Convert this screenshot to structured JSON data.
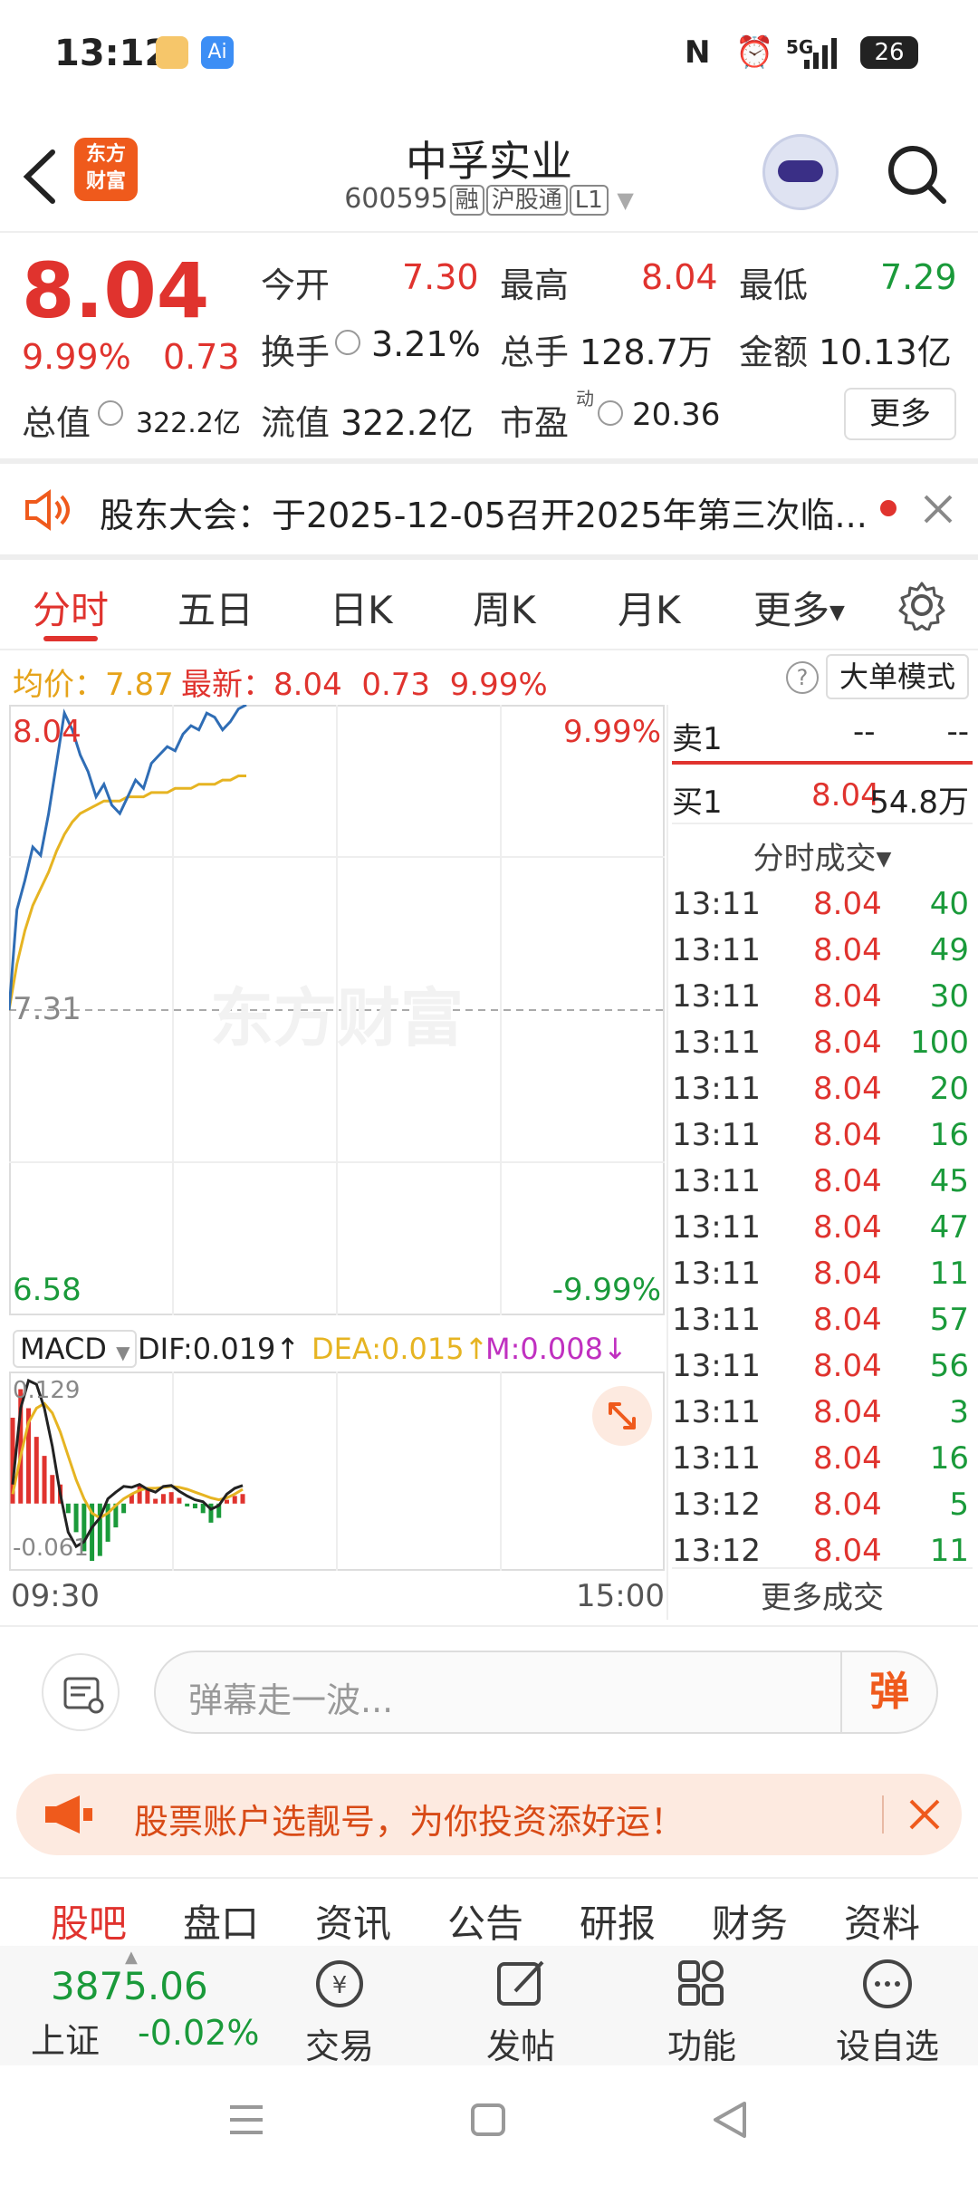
{
  "status_bar": {
    "time": "13:12",
    "battery": "26",
    "network": "5G"
  },
  "header": {
    "logo_line1": "东方",
    "logo_line2": "财富",
    "stock_name": "中孚实业",
    "stock_code": "600595",
    "tags": [
      "融",
      "沪股通",
      "L1"
    ]
  },
  "quote": {
    "price": "8.04",
    "pct": "9.99%",
    "chg": "0.73",
    "open_label": "今开",
    "open": "7.30",
    "high_label": "最高",
    "high": "8.04",
    "low_label": "最低",
    "low": "7.29",
    "turnover_label": "换手",
    "turnover": "3.21%",
    "volume_label": "总手",
    "volume": "128.7万",
    "amount_label": "金额",
    "amount": "10.13亿",
    "mktcap_label": "总值",
    "mktcap": "322.2亿",
    "float_label": "流值",
    "float": "322.2亿",
    "pe_label": "市盈",
    "pe_sup": "动",
    "pe": "20.36",
    "more": "更多"
  },
  "notice": {
    "text": "股东大会：于2025-12-05召开2025年第三次临..."
  },
  "tabs": [
    "分时",
    "五日",
    "日K",
    "周K",
    "月K",
    "更多"
  ],
  "info_line": {
    "avg_label": "均价：",
    "avg": "7.87",
    "latest_label": "最新：",
    "latest": "8.04",
    "chg": "0.73",
    "pct": "9.99%",
    "big_order": "大单模式"
  },
  "chart": {
    "top_price": "8.04",
    "top_pct": "9.99%",
    "mid_price": "7.31",
    "bottom_price": "6.58",
    "bottom_pct": "-9.99%",
    "watermark": "东方财富",
    "time_start": "09:30",
    "time_end": "15:00"
  },
  "chart_data": {
    "type": "line",
    "ylim": [
      6.58,
      8.04
    ],
    "series": [
      {
        "name": "price",
        "values": [
          7.31,
          7.55,
          7.62,
          7.7,
          7.68,
          7.78,
          7.9,
          8.02,
          7.98,
          7.92,
          7.88,
          7.82,
          7.85,
          7.8,
          7.78,
          7.82,
          7.86,
          7.84,
          7.9,
          7.92,
          7.94,
          7.93,
          7.97,
          7.99,
          7.98,
          8.02,
          8.01,
          7.98,
          8.0,
          8.03,
          8.04
        ]
      },
      {
        "name": "avg",
        "values": [
          7.31,
          7.42,
          7.5,
          7.56,
          7.6,
          7.64,
          7.69,
          7.73,
          7.76,
          7.78,
          7.79,
          7.8,
          7.81,
          7.81,
          7.81,
          7.82,
          7.82,
          7.82,
          7.83,
          7.83,
          7.83,
          7.84,
          7.84,
          7.84,
          7.85,
          7.85,
          7.85,
          7.86,
          7.86,
          7.87,
          7.87
        ]
      }
    ]
  },
  "macd": {
    "label": "MACD",
    "dif": "DIF:0.019↑",
    "dea": "DEA:0.015↑",
    "m": "M:0.008↓",
    "top": "0.129",
    "bottom": "-0.061"
  },
  "macd_data": {
    "hist": [
      0.09,
      0.12,
      0.1,
      0.07,
      0.05,
      0.03,
      0.02,
      -0.01,
      -0.03,
      -0.05,
      -0.06,
      -0.055,
      -0.04,
      -0.025,
      -0.01,
      0.01,
      0.02,
      0.015,
      0.005,
      0.01,
      0.012,
      0.006,
      -0.003,
      -0.005,
      -0.01,
      -0.02,
      -0.015,
      0.004,
      0.008,
      0.01
    ],
    "dif": [
      0.02,
      0.1,
      0.129,
      0.125,
      0.1,
      0.06,
      0.01,
      -0.03,
      -0.045,
      -0.04,
      -0.025,
      -0.015,
      0.005,
      0.012,
      0.018,
      0.017,
      0.02,
      0.015,
      0.012,
      0.018,
      0.019,
      0.013,
      0.008,
      0.004,
      0.002,
      -0.006,
      -0.002,
      0.01,
      0.016,
      0.019
    ],
    "dea": [
      0.01,
      0.05,
      0.085,
      0.1,
      0.105,
      0.095,
      0.075,
      0.05,
      0.025,
      0.005,
      -0.01,
      -0.015,
      -0.01,
      -0.002,
      0.005,
      0.01,
      0.014,
      0.016,
      0.016,
      0.017,
      0.018,
      0.017,
      0.015,
      0.012,
      0.009,
      0.006,
      0.004,
      0.006,
      0.01,
      0.015
    ]
  },
  "order_book": {
    "sell1_label": "卖1",
    "sell1_price": "--",
    "sell1_vol": "--",
    "buy1_label": "买1",
    "buy1_price": "8.04",
    "buy1_vol": "54.8万"
  },
  "ticks_title": "分时成交",
  "ticks": [
    {
      "t": "13:11",
      "p": "8.04",
      "v": "40"
    },
    {
      "t": "13:11",
      "p": "8.04",
      "v": "49"
    },
    {
      "t": "13:11",
      "p": "8.04",
      "v": "30"
    },
    {
      "t": "13:11",
      "p": "8.04",
      "v": "100"
    },
    {
      "t": "13:11",
      "p": "8.04",
      "v": "20"
    },
    {
      "t": "13:11",
      "p": "8.04",
      "v": "16"
    },
    {
      "t": "13:11",
      "p": "8.04",
      "v": "45"
    },
    {
      "t": "13:11",
      "p": "8.04",
      "v": "47"
    },
    {
      "t": "13:11",
      "p": "8.04",
      "v": "11"
    },
    {
      "t": "13:11",
      "p": "8.04",
      "v": "57"
    },
    {
      "t": "13:11",
      "p": "8.04",
      "v": "56"
    },
    {
      "t": "13:11",
      "p": "8.04",
      "v": "3"
    },
    {
      "t": "13:11",
      "p": "8.04",
      "v": "16"
    },
    {
      "t": "13:12",
      "p": "8.04",
      "v": "5"
    },
    {
      "t": "13:12",
      "p": "8.04",
      "v": "11"
    }
  ],
  "more_ticks": "更多成交",
  "comment": {
    "placeholder": "弹幕走一波...",
    "danmu": "弹"
  },
  "promo": {
    "text": "股票账户选靓号，为你投资添好运！"
  },
  "bottom_tabs": [
    "股吧",
    "盘口",
    "资讯",
    "公告",
    "研报",
    "财务",
    "资料"
  ],
  "index": {
    "value": "3875.06",
    "name": "上证",
    "pct": "-0.02%"
  },
  "nav": [
    {
      "label": "交易"
    },
    {
      "label": "发帖"
    },
    {
      "label": "功能"
    },
    {
      "label": "设自选"
    }
  ],
  "colors": {
    "up": "#e0332e",
    "down": "#1a9a3a",
    "brand": "#ef5a1c",
    "line": "#2f6db5",
    "avg": "#e6b422"
  }
}
